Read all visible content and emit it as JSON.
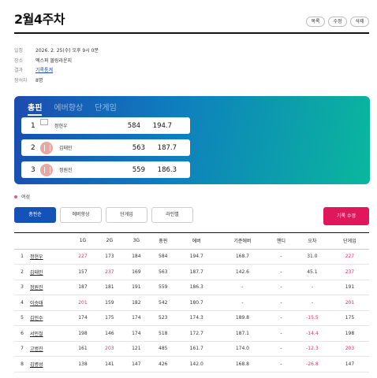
{
  "header": {
    "title": "2월4주차",
    "buttons": [
      "목록",
      "수정",
      "삭제"
    ]
  },
  "info": {
    "rows": [
      {
        "label": "일정",
        "value": "2026. 2. 25(수) 오후 9시 0분"
      },
      {
        "label": "장소",
        "value": "엑스퍼 볼링라운지"
      },
      {
        "label": "결과",
        "value": "기록통계"
      },
      {
        "label": "참석자",
        "value": "8명"
      }
    ]
  },
  "podium": {
    "tabs": [
      "총핀",
      "에버향상",
      "단게임"
    ],
    "entries": [
      {
        "rank": "1",
        "name": "정현우",
        "total": "584",
        "avg": "194.7",
        "has_avatar": false
      },
      {
        "rank": "2",
        "name": "김태민",
        "total": "563",
        "avg": "187.7",
        "has_avatar": true
      },
      {
        "rank": "3",
        "name": "정원진",
        "total": "559",
        "avg": "186.3",
        "has_avatar": true
      }
    ]
  },
  "legend": {
    "label": "여성",
    "color": "#e0607a"
  },
  "view_tabs": [
    "총핀순",
    "에버향상",
    "단게임",
    "라인별"
  ],
  "save_button": "기록 수정",
  "table": {
    "headers": [
      "",
      "",
      "1G",
      "2G",
      "3G",
      "총핀",
      "에버",
      "기준에버",
      "핸디",
      "오차",
      "단게임"
    ],
    "rows": [
      {
        "rank": "1",
        "name": "정현우",
        "g1": "227",
        "g2": "173",
        "g3": "184",
        "total": "584",
        "avg": "194.7",
        "base": "168.7",
        "handi": "-",
        "diff": "31.0",
        "best": "227",
        "hl": [
          "g1",
          "best"
        ]
      },
      {
        "rank": "2",
        "name": "김태민",
        "g1": "157",
        "g2": "237",
        "g3": "169",
        "total": "563",
        "avg": "187.7",
        "base": "142.6",
        "handi": "-",
        "diff": "45.1",
        "best": "237",
        "hl": [
          "g2",
          "best"
        ]
      },
      {
        "rank": "3",
        "name": "정원진",
        "g1": "187",
        "g2": "181",
        "g3": "191",
        "total": "559",
        "avg": "186.3",
        "base": "-",
        "handi": "-",
        "diff": "-",
        "best": "191",
        "hl": []
      },
      {
        "rank": "4",
        "name": "이승태",
        "g1": "201",
        "g2": "159",
        "g3": "182",
        "total": "542",
        "avg": "180.7",
        "base": "-",
        "handi": "-",
        "diff": "-",
        "best": "201",
        "hl": [
          "g1",
          "best"
        ]
      },
      {
        "rank": "5",
        "name": "김민수",
        "g1": "174",
        "g2": "175",
        "g3": "174",
        "total": "523",
        "avg": "174.3",
        "base": "189.8",
        "handi": "-",
        "diff": "-15.5",
        "best": "175",
        "hl": [
          "diff"
        ]
      },
      {
        "rank": "6",
        "name": "서민철",
        "g1": "198",
        "g2": "146",
        "g3": "174",
        "total": "518",
        "avg": "172.7",
        "base": "187.1",
        "handi": "-",
        "diff": "-14.4",
        "best": "198",
        "hl": [
          "diff"
        ]
      },
      {
        "rank": "7",
        "name": "고범진",
        "g1": "161",
        "g2": "203",
        "g3": "121",
        "total": "485",
        "avg": "161.7",
        "base": "174.0",
        "handi": "-",
        "diff": "-12.3",
        "best": "203",
        "hl": [
          "g2",
          "diff",
          "best"
        ]
      },
      {
        "rank": "8",
        "name": "김병성",
        "g1": "138",
        "g2": "141",
        "g3": "147",
        "total": "426",
        "avg": "142.0",
        "base": "168.8",
        "handi": "-",
        "diff": "-26.8",
        "best": "147",
        "hl": [
          "diff"
        ]
      }
    ]
  }
}
